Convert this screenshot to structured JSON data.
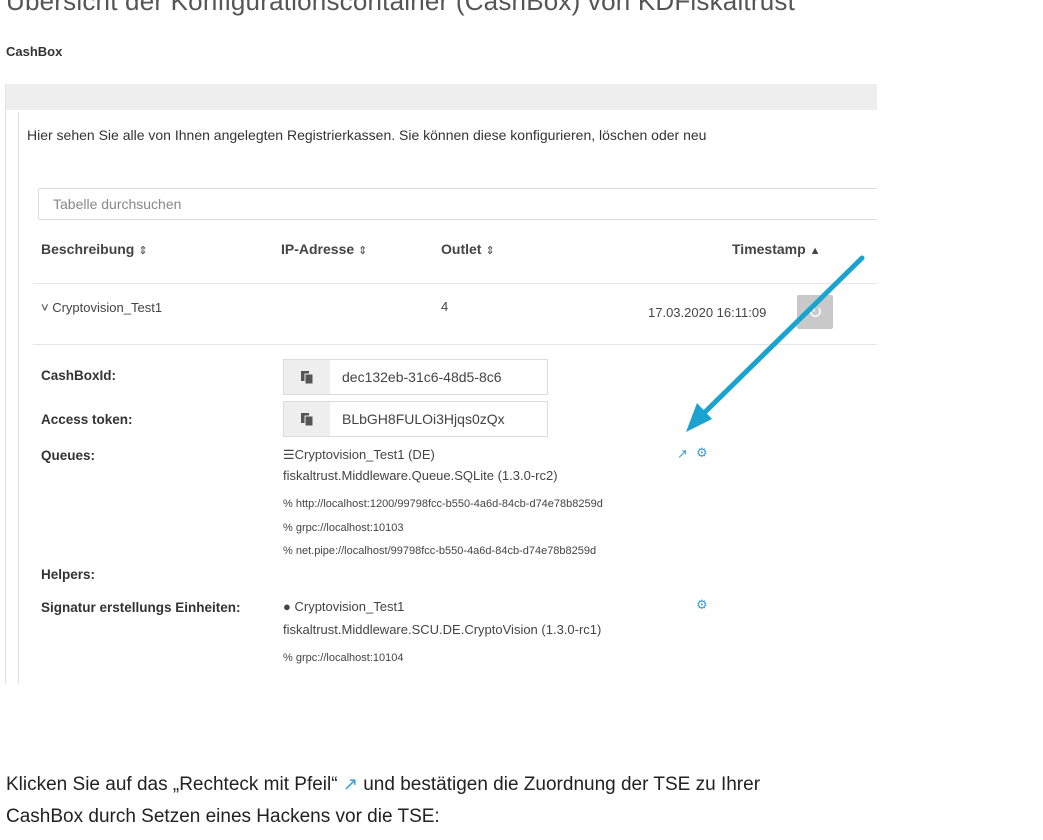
{
  "page": {
    "heading": "Übersicht der Konfigurationscontainer (CashBox) von KDFiskaltrust",
    "breadcrumb": "CashBox"
  },
  "panel": {
    "intro": "Hier sehen Sie alle von Ihnen angelegten Registrierkassen. Sie können diese konfigurieren, löschen oder neu",
    "search_placeholder": "Tabelle durchsuchen",
    "columns": [
      {
        "label": "Beschreibung",
        "sort": "⇕"
      },
      {
        "label": "IP-Adresse",
        "sort": "⇕"
      },
      {
        "label": "Outlet",
        "sort": "⇕"
      },
      {
        "label": "Timestamp",
        "sort": "▲"
      }
    ],
    "row": {
      "toggle": "˅",
      "description": "Cryptovision_Test1",
      "ip": "",
      "outlet": "4",
      "timestamp": "17.03.2020 16:11:09"
    },
    "details": {
      "cashboxid_label": "CashBoxId:",
      "cashboxid_value": "dec132eb-31c6-48d5-8c6",
      "token_label": "Access token:",
      "token_value": "BLbGH8FULOi3Hjqs0zQx",
      "queues_label": "Queues:",
      "queue_name": "Cryptovision_Test1 (DE)",
      "queue_package": "fiskaltrust.Middleware.Queue.SQLite (1.3.0-rc2)",
      "queue_urls": [
        "http://localhost:1200/99798fcc-b550-4a6d-84cb-d74e78b8259d",
        "grpc://localhost:10103",
        "net.pipe://localhost/99798fcc-b550-4a6d-84cb-d74e78b8259d"
      ],
      "helpers_label": "Helpers:",
      "scu_label": "Signatur erstellungs Einheiten:",
      "scu_name": "Cryptovision_Test1",
      "scu_package": "fiskaltrust.Middleware.SCU.DE.CryptoVision (1.3.0-rc1)",
      "scu_url": "grpc://localhost:10104"
    }
  },
  "instructions": {
    "line1_before": "Klicken Sie auf das „Rechteck mit Pfeil“",
    "line1_after": "und bestätigen die Zuordnung der TSE zu Ihrer",
    "line2": "CashBox durch Setzen eines Hackens vor die TSE:"
  },
  "colors": {
    "accent": "#3a9bd8",
    "arrow": "#1aa3cf"
  },
  "icons": [
    "copy-icon",
    "database-icon",
    "link-icon",
    "external-link-icon",
    "gear-icon",
    "refresh-icon",
    "circle-icon"
  ]
}
